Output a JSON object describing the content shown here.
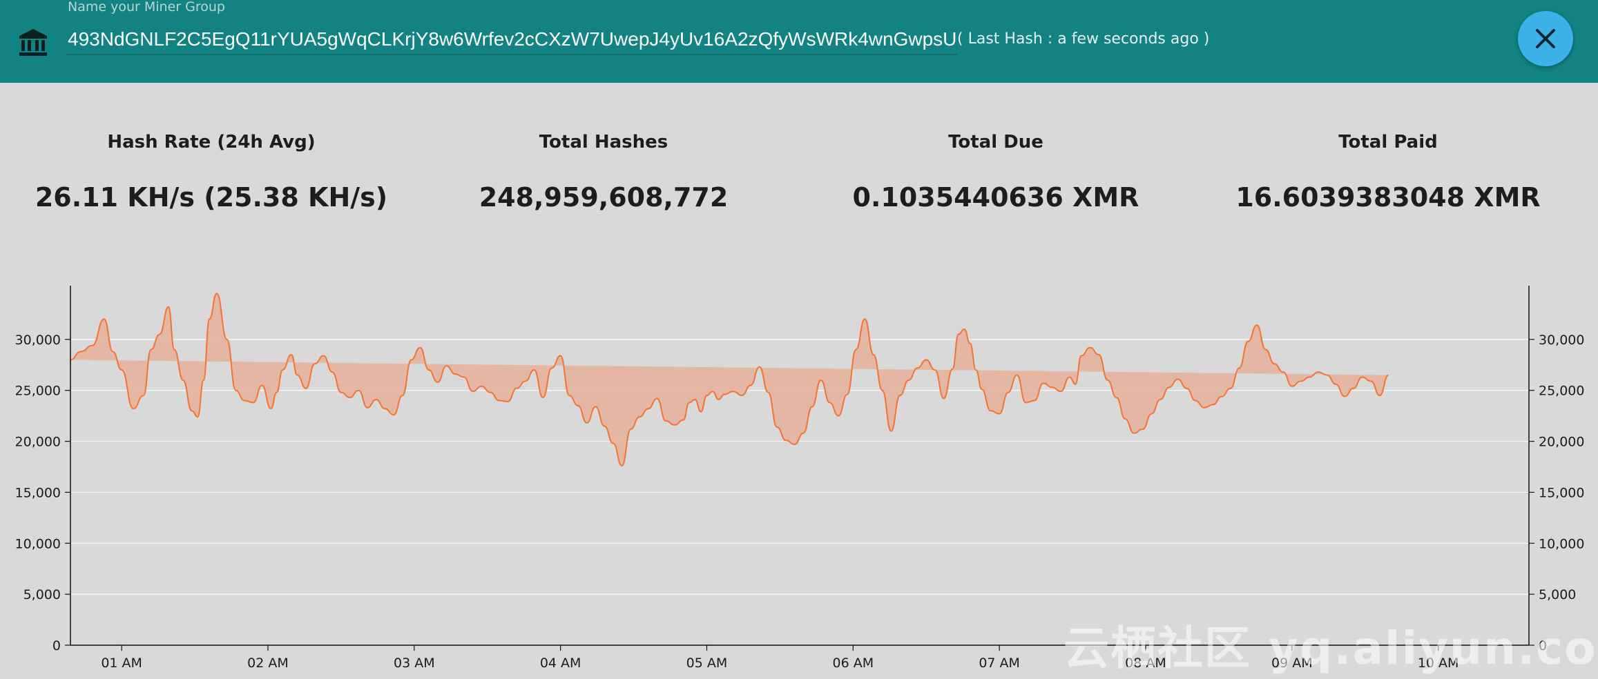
{
  "header": {
    "field_label": "Name your Miner Group",
    "address": "493NdGNLF2C5EgQ11rYUA5gWqCLKrjY8w6Wrfev2cCXzW7UwepJ4yUv16A2zQfyWsWRk4wnGwpsU",
    "last_hash": "( Last Hash : a few seconds ago )",
    "icon": "bank-icon",
    "close_icon": "close-icon"
  },
  "stats": [
    {
      "label": "Hash Rate (24h Avg)",
      "value": "26.11 KH/s (25.38 KH/s)"
    },
    {
      "label": "Total Hashes",
      "value": "248,959,608,772"
    },
    {
      "label": "Total Due",
      "value": "0.1035440636 XMR"
    },
    {
      "label": "Total Paid",
      "value": "16.6039383048 XMR"
    }
  ],
  "colors": {
    "header": "#128282",
    "background": "#d9d9d9",
    "close_button": "#3db2e8",
    "line": "#f47433",
    "area": "#e4b5a1"
  },
  "watermark": "云栖社区 yq.aliyun.com",
  "chart_data": {
    "type": "area",
    "y_ticks": [
      "0",
      "5,000",
      "10,000",
      "15,000",
      "20,000",
      "25,000",
      "30,000"
    ],
    "y_ticks_right": [
      "0",
      "5,000",
      "10,000",
      "15,000",
      "20,000",
      "25,000",
      "30,000"
    ],
    "x_ticks": [
      "01 AM",
      "02 AM",
      "03 AM",
      "04 AM",
      "05 AM",
      "06 AM",
      "07 AM",
      "08 AM",
      "09 AM",
      "10 AM"
    ],
    "x_tick_positions": [
      1,
      2,
      3,
      4,
      5,
      6,
      7,
      8,
      9,
      10
    ],
    "xlim": [
      0.65,
      10.62
    ],
    "ylim": [
      0,
      35000
    ],
    "grid": true,
    "x": [
      0.65,
      0.72,
      0.8,
      0.88,
      0.94,
      1.0,
      1.08,
      1.15,
      1.2,
      1.26,
      1.32,
      1.36,
      1.42,
      1.48,
      1.52,
      1.56,
      1.6,
      1.65,
      1.72,
      1.78,
      1.84,
      1.9,
      1.96,
      2.02,
      2.06,
      2.1,
      2.16,
      2.2,
      2.26,
      2.32,
      2.38,
      2.44,
      2.5,
      2.56,
      2.62,
      2.68,
      2.74,
      2.8,
      2.86,
      2.92,
      2.98,
      3.04,
      3.1,
      3.16,
      3.22,
      3.28,
      3.34,
      3.4,
      3.46,
      3.52,
      3.58,
      3.64,
      3.7,
      3.76,
      3.82,
      3.88,
      3.94,
      4.0,
      4.06,
      4.12,
      4.18,
      4.24,
      4.3,
      4.36,
      4.42,
      4.48,
      4.54,
      4.6,
      4.66,
      4.72,
      4.78,
      4.84,
      4.88,
      4.92,
      4.96,
      5.0,
      5.04,
      5.08,
      5.12,
      5.18,
      5.24,
      5.3,
      5.36,
      5.42,
      5.48,
      5.54,
      5.6,
      5.66,
      5.72,
      5.78,
      5.84,
      5.9,
      5.96,
      6.02,
      6.08,
      6.14,
      6.2,
      6.26,
      6.32,
      6.38,
      6.44,
      6.5,
      6.56,
      6.62,
      6.68,
      6.72,
      6.76,
      6.8,
      6.84,
      6.88,
      6.94,
      7.0,
      7.06,
      7.12,
      7.18,
      7.24,
      7.3,
      7.36,
      7.42,
      7.48,
      7.52,
      7.56,
      7.62,
      7.68,
      7.74,
      7.8,
      7.86,
      7.92,
      7.98,
      8.04,
      8.1,
      8.16,
      8.22,
      8.28,
      8.34,
      8.4,
      8.46,
      8.52,
      8.58,
      8.64,
      8.7,
      8.76,
      8.82,
      8.88,
      8.94,
      9.0,
      9.06,
      9.12,
      9.18,
      9.24,
      9.3,
      9.36,
      9.42,
      9.48,
      9.54,
      9.6,
      9.66,
      9.72,
      9.78,
      9.84,
      9.88,
      9.92,
      9.96,
      10.0,
      10.04,
      10.1,
      10.16,
      10.22,
      10.28,
      10.34,
      10.4,
      10.46,
      10.52,
      10.58,
      10.62
    ],
    "y": [
      28000,
      28800,
      29400,
      32000,
      28800,
      27000,
      23200,
      24500,
      29000,
      30500,
      33200,
      29000,
      26000,
      23000,
      22400,
      26000,
      32000,
      34500,
      30000,
      25000,
      24000,
      23800,
      25500,
      23200,
      24800,
      27000,
      28500,
      26500,
      25200,
      27600,
      28400,
      26800,
      24800,
      24300,
      25000,
      23300,
      24100,
      23200,
      22600,
      24500,
      28000,
      29200,
      27000,
      25800,
      27400,
      26600,
      26300,
      24900,
      25400,
      24800,
      24000,
      23900,
      25200,
      25900,
      27000,
      24300,
      27200,
      28400,
      24500,
      23500,
      21800,
      23400,
      21500,
      19800,
      17600,
      21200,
      22400,
      23200,
      24200,
      22000,
      21600,
      22100,
      23800,
      24100,
      22900,
      24500,
      24900,
      24100,
      24600,
      24900,
      24500,
      25500,
      27300,
      24800,
      21400,
      20100,
      19700,
      20800,
      23400,
      26000,
      23800,
      22500,
      24600,
      29000,
      32000,
      28500,
      25000,
      21000,
      24500,
      26000,
      27200,
      28000,
      27000,
      24200,
      27100,
      30500,
      31000,
      29600,
      27000,
      25100,
      23000,
      22700,
      24800,
      26500,
      23800,
      24000,
      25700,
      25300,
      24900,
      26300,
      25600,
      28400,
      29200,
      28500,
      26000,
      24300,
      22200,
      20800,
      21200,
      22700,
      24100,
      25300,
      26100,
      25200,
      24000,
      23300,
      23600,
      24400,
      25200,
      27200,
      29800,
      31400,
      29000,
      27600,
      26800,
      25400,
      25900,
      26300,
      26800,
      26500,
      25600,
      24400,
      25200,
      26300,
      25900,
      24500,
      26500
    ],
    "y2": []
  }
}
